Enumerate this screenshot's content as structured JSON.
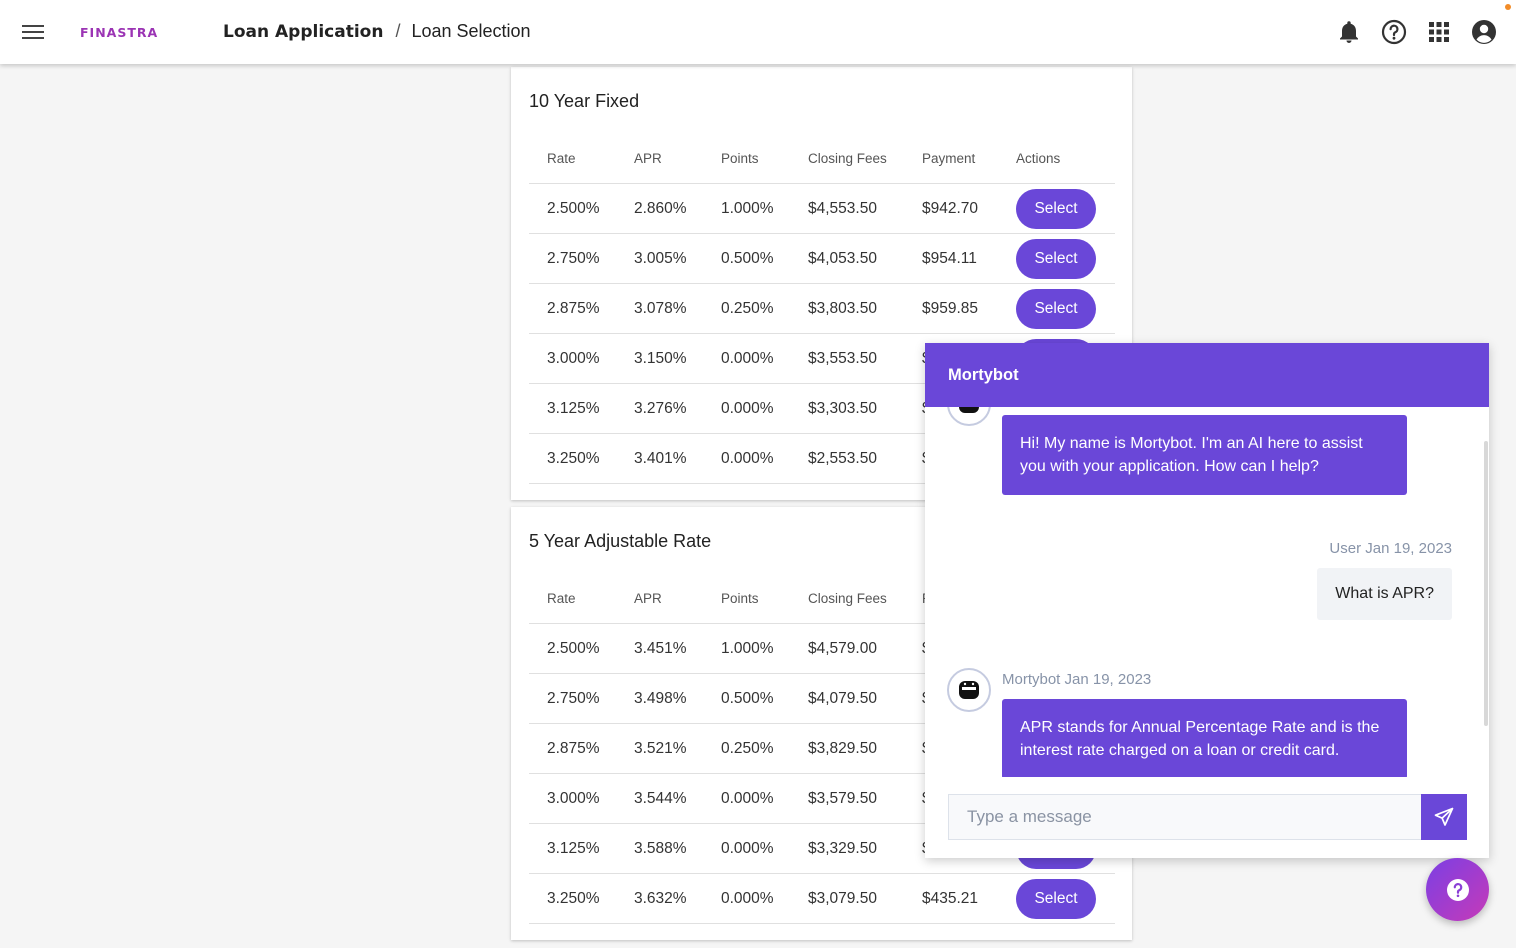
{
  "header": {
    "brand": "FINASTRA",
    "breadcrumb_app": "Loan Application",
    "breadcrumb_sep": "/",
    "breadcrumb_page": "Loan Selection",
    "icons": [
      "menu-icon",
      "bell-icon",
      "help-circle-icon",
      "apps-grid-icon",
      "account-circle-icon"
    ]
  },
  "table_columns": [
    "Rate",
    "APR",
    "Points",
    "Closing Fees",
    "Payment",
    "Actions"
  ],
  "loans": [
    {
      "title": "10 Year Fixed",
      "rows": [
        {
          "rate": "2.500%",
          "apr": "2.860%",
          "points": "1.000%",
          "fees": "$4,553.50",
          "payment": "$942.70",
          "action": "Select"
        },
        {
          "rate": "2.750%",
          "apr": "3.005%",
          "points": "0.500%",
          "fees": "$4,053.50",
          "payment": "$954.11",
          "action": "Select"
        },
        {
          "rate": "2.875%",
          "apr": "3.078%",
          "points": "0.250%",
          "fees": "$3,803.50",
          "payment": "$959.85",
          "action": "Select"
        },
        {
          "rate": "3.000%",
          "apr": "3.150%",
          "points": "0.000%",
          "fees": "$3,553.50",
          "payment": "$",
          "action": ""
        },
        {
          "rate": "3.125%",
          "apr": "3.276%",
          "points": "0.000%",
          "fees": "$3,303.50",
          "payment": "$",
          "action": ""
        },
        {
          "rate": "3.250%",
          "apr": "3.401%",
          "points": "0.000%",
          "fees": "$2,553.50",
          "payment": "$",
          "action": ""
        }
      ]
    },
    {
      "title": "5 Year Adjustable Rate",
      "rows": [
        {
          "rate": "2.500%",
          "apr": "3.451%",
          "points": "1.000%",
          "fees": "$4,579.00",
          "payment": "$",
          "action": ""
        },
        {
          "rate": "2.750%",
          "apr": "3.498%",
          "points": "0.500%",
          "fees": "$4,079.50",
          "payment": "$",
          "action": ""
        },
        {
          "rate": "2.875%",
          "apr": "3.521%",
          "points": "0.250%",
          "fees": "$3,829.50",
          "payment": "$",
          "action": ""
        },
        {
          "rate": "3.000%",
          "apr": "3.544%",
          "points": "0.000%",
          "fees": "$3,579.50",
          "payment": "$",
          "action": ""
        },
        {
          "rate": "3.125%",
          "apr": "3.588%",
          "points": "0.000%",
          "fees": "$3,329.50",
          "payment": "$",
          "action": ""
        },
        {
          "rate": "3.250%",
          "apr": "3.632%",
          "points": "0.000%",
          "fees": "$3,079.50",
          "payment": "$435.21",
          "action": "Select"
        }
      ]
    }
  ],
  "chat": {
    "title": "Mortybot",
    "greeting": "Hi! My name is Mortybot. I'm an AI here to assist you with your application. How can I help?",
    "user_meta": "User Jan 19, 2023",
    "user_message": "What is APR?",
    "bot_meta": "Mortybot Jan 19, 2023",
    "bot_reply": "APR stands for Annual Percentage Rate and is the interest rate charged on a loan or credit card.",
    "input_placeholder": "Type a message"
  },
  "colors": {
    "accent": "#6a47d8",
    "brand": "#9b34b4",
    "fab_start": "#7b3fe4",
    "fab_end": "#c63ab8",
    "notify": "#f28c28"
  }
}
